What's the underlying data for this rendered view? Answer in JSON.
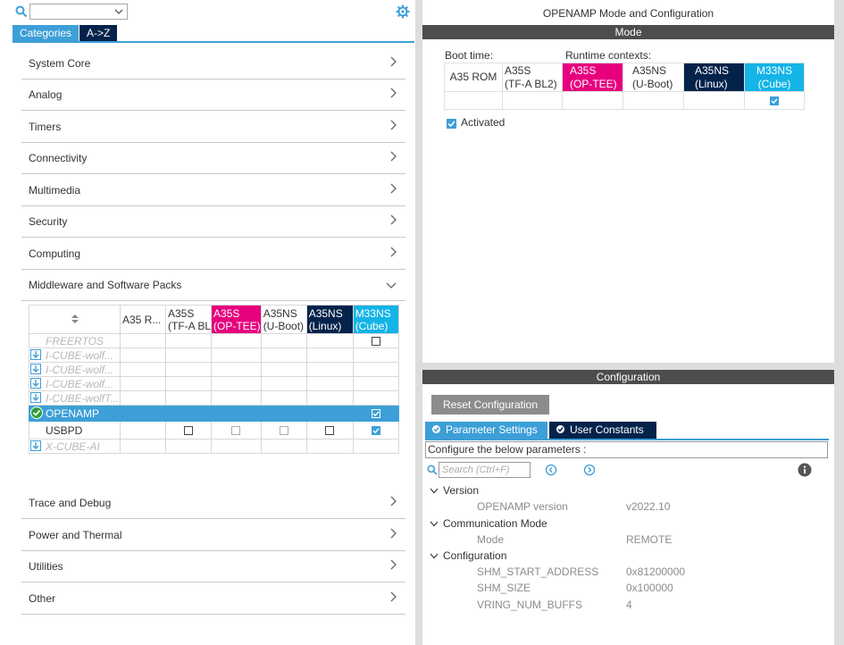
{
  "left": {
    "tabs": {
      "categories": "Categories",
      "az": "A->Z"
    },
    "categories": [
      "System Core",
      "Analog",
      "Timers",
      "Connectivity",
      "Multimedia",
      "Security",
      "Computing",
      "Middleware and Software Packs"
    ],
    "categories_after": [
      "Trace and Debug",
      "Power and Thermal",
      "Utilities",
      "Other"
    ],
    "contexts": [
      {
        "l1": "A35 R...",
        "l2": ""
      },
      {
        "l1": "A35S",
        "l2": "(TF-A  BL"
      },
      {
        "l1": "A35S",
        "l2": "(OP-TEE)"
      },
      {
        "l1": "A35NS",
        "l2": "(U-Boot)"
      },
      {
        "l1": "A35NS",
        "l2": "(Linux)"
      },
      {
        "l1": "M33NS",
        "l2": "(Cube)"
      }
    ],
    "middleware": [
      {
        "name": "FREERTOS"
      },
      {
        "name": "I-CUBE-wolf..."
      },
      {
        "name": "I-CUBE-wolf..."
      },
      {
        "name": "I-CUBE-wolf..."
      },
      {
        "name": "I-CUBE-wolfT..."
      },
      {
        "name": "OPENAMP"
      },
      {
        "name": "USBPD"
      },
      {
        "name": "X-CUBE-AI"
      }
    ]
  },
  "right": {
    "title": "OPENAMP Mode and Configuration",
    "mode_bar": "Mode",
    "boot_time_label": "Boot time:",
    "runtime_label": "Runtime contexts:",
    "mode_columns": [
      {
        "l1": "A35 ROM",
        "l2": ""
      },
      {
        "l1": "A35S",
        "l2": "(TF-A  BL2)"
      },
      {
        "l1": "A35S",
        "l2": "(OP-TEE)"
      },
      {
        "l1": "A35NS",
        "l2": "(U-Boot)"
      },
      {
        "l1": "A35NS",
        "l2": "(Linux)"
      },
      {
        "l1": "M33NS",
        "l2": "(Cube)"
      }
    ],
    "activated_label": "Activated",
    "config_bar": "Configuration",
    "reset_button": "Reset Configuration",
    "tab_params": "Parameter Settings",
    "tab_user": "User Constants",
    "configure_note": "Configure the below parameters :",
    "search_placeholder": "Search (Ctrl+F)",
    "tree": {
      "version_group": "Version",
      "version_key": "OPENAMP version",
      "version_val": "v2022.10",
      "comm_group": "Communication Mode",
      "mode_key": "Mode",
      "mode_val": "REMOTE",
      "config_group": "Configuration",
      "shm_start_key": "SHM_START_ADDRESS",
      "shm_start_val": "0x81200000",
      "shm_size_key": "SHM_SIZE",
      "shm_size_val": "0x100000",
      "vring_key": "VRING_NUM_BUFFS",
      "vring_val": "4"
    }
  },
  "colors": {
    "accent_blue": "#3d9fd7",
    "navy": "#03234b",
    "magenta": "#e6007e",
    "cyan": "#14b4e6",
    "bar_gray": "#4d4d4d"
  }
}
